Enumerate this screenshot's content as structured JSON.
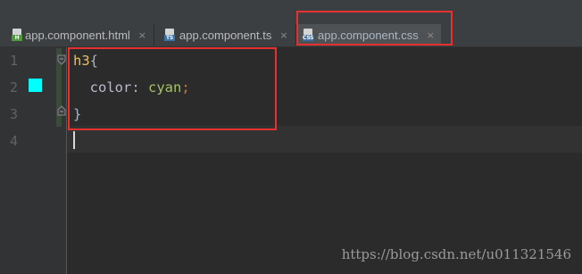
{
  "tabs": [
    {
      "label": "app.component.html",
      "icon": "html-file-icon",
      "badge": "H",
      "close": "×",
      "active": false
    },
    {
      "label": "app.component.ts",
      "icon": "typescript-file-icon",
      "badge": "TS",
      "close": "×",
      "active": false
    },
    {
      "label": "app.component.css",
      "icon": "css-file-icon",
      "badge": "CSS",
      "close": "×",
      "active": true
    }
  ],
  "gutter": {
    "line_numbers": [
      "1",
      "2",
      "3",
      "4"
    ],
    "color_swatch": "#00ffff"
  },
  "code": {
    "line1_selector": "h3",
    "line1_brace": "{",
    "line2_property": "color",
    "line2_colon": ": ",
    "line2_value": "cyan",
    "line2_semicolon": ";",
    "line3_brace": "}"
  },
  "colors": {
    "annotation": "#e8312f",
    "editor_bg": "#2b2b2b",
    "selector": "#e8bf6a",
    "value": "#a5c261"
  },
  "watermark": "https://blog.csdn.net/u011321546"
}
